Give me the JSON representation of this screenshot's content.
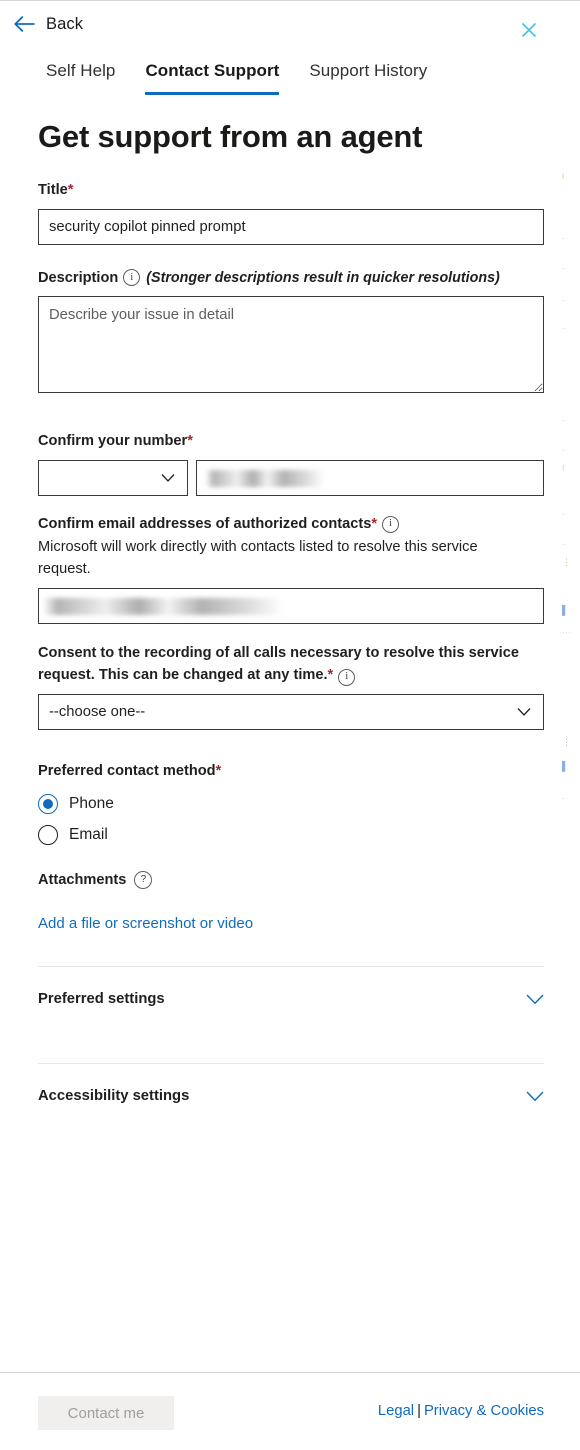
{
  "header": {
    "back_label": "Back",
    "back_icon": "arrow-left-icon",
    "close_icon": "close-icon",
    "close_color": "#3ec6e0",
    "accent_color": "#0f6cbd"
  },
  "tabs": [
    {
      "label": "Self Help",
      "active": false
    },
    {
      "label": "Contact Support",
      "active": true
    },
    {
      "label": "Support History",
      "active": false
    }
  ],
  "page": {
    "title": "Get support from an agent"
  },
  "form": {
    "title_field": {
      "label": "Title",
      "required_marker": "*",
      "value": "security copilot pinned prompt"
    },
    "description_field": {
      "label": "Description",
      "info_icon": "info-icon",
      "hint": "(Stronger descriptions result in quicker resolutions)",
      "placeholder": "Describe your issue in detail",
      "value": ""
    },
    "number_field": {
      "label": "Confirm your number",
      "required_marker": "*",
      "country_code_value": "",
      "chevron_icon": "chevron-down-icon",
      "number_value": "",
      "number_redacted": true
    },
    "email_field": {
      "label": "Confirm email addresses of authorized contacts",
      "required_marker": "*",
      "info_icon": "info-icon",
      "description": "Microsoft will work directly with contacts listed to resolve this service request.",
      "value": "",
      "value_redacted": true
    },
    "consent_field": {
      "label": "Consent to the recording of all calls necessary to resolve this service request. This can be changed at any time.",
      "required_marker": "*",
      "info_icon": "info-icon",
      "selected": "--choose one--",
      "chevron_icon": "chevron-down-icon"
    },
    "contact_method": {
      "label": "Preferred contact method",
      "required_marker": "*",
      "options": [
        {
          "label": "Phone",
          "selected": true
        },
        {
          "label": "Email",
          "selected": false
        }
      ]
    },
    "attachments": {
      "label": "Attachments",
      "help_icon": "question-mark-icon",
      "add_link": "Add a file or screenshot or video"
    }
  },
  "accordions": [
    {
      "label": "Preferred settings",
      "chevron_icon": "chevron-down-icon",
      "expanded": false
    },
    {
      "label": "Accessibility settings",
      "chevron_icon": "chevron-down-icon",
      "expanded": false
    }
  ],
  "footer": {
    "submit_label": "Contact me",
    "submit_disabled": true,
    "legal_label": "Legal",
    "separator": "|",
    "privacy_label": "Privacy & Cookies"
  }
}
